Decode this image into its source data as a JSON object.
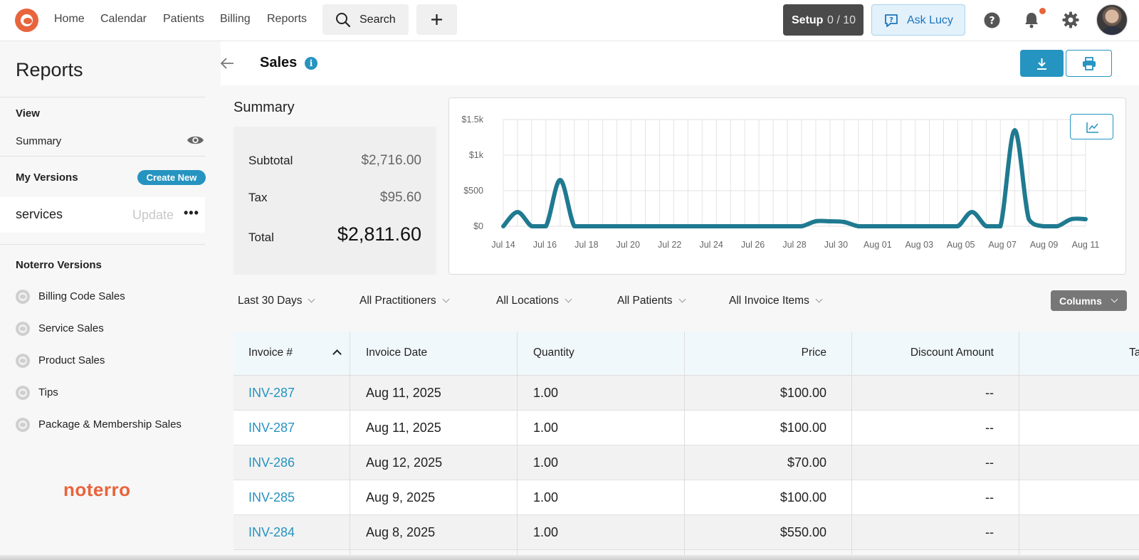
{
  "topnav": {
    "items": [
      "Home",
      "Calendar",
      "Patients",
      "Billing",
      "Reports"
    ],
    "search_label": "Search",
    "setup_label": "Setup",
    "setup_progress": "0 / 10",
    "ask_lucy_label": "Ask Lucy",
    "accent_color": "#e8643c"
  },
  "sidebar": {
    "title": "Reports",
    "view_heading": "View",
    "view_item": "Summary",
    "my_versions_heading": "My Versions",
    "create_new_label": "Create New",
    "version": {
      "name": "services",
      "update_label": "Update",
      "more_label": "•••"
    },
    "noterro_versions_heading": "Noterro Versions",
    "noterro_versions": [
      "Billing Code Sales",
      "Service Sales",
      "Product Sales",
      "Tips",
      "Package & Membership Sales"
    ],
    "brand": "noterro"
  },
  "page": {
    "title": "Sales",
    "summary_label": "Summary",
    "summary": {
      "subtotal_label": "Subtotal",
      "subtotal": "$2,716.00",
      "tax_label": "Tax",
      "tax": "$95.60",
      "total_label": "Total",
      "total": "$2,811.60"
    }
  },
  "chart_data": {
    "type": "line",
    "x_ticks": [
      "Jul 14",
      "Jul 16",
      "Jul 18",
      "Jul 20",
      "Jul 22",
      "Jul 24",
      "Jul 26",
      "Jul 28",
      "Jul 30",
      "Aug 01",
      "Aug 03",
      "Aug 05",
      "Aug 07",
      "Aug 09",
      "Aug 11"
    ],
    "y_ticks": [
      "$1.5k",
      "$1k",
      "$500",
      "$0"
    ],
    "ylim": [
      0,
      1500
    ],
    "series": [
      {
        "color": "#1f7a90",
        "values": [
          0,
          200,
          0,
          0,
          650,
          0,
          0,
          0,
          0,
          0,
          0,
          0,
          0,
          0,
          0,
          0,
          0,
          0,
          0,
          0,
          0,
          0,
          70,
          70,
          60,
          0,
          0,
          0,
          0,
          0,
          0,
          0,
          0,
          200,
          0,
          0,
          1350,
          100,
          0,
          0,
          100,
          100
        ]
      }
    ],
    "grid": true
  },
  "filters": [
    "Last 30 Days",
    "All Practitioners",
    "All Locations",
    "All Patients",
    "All Invoice Items"
  ],
  "columns_label": "Columns",
  "table": {
    "headers": [
      "Invoice #",
      "Invoice Date",
      "Quantity",
      "Price",
      "Discount Amount",
      "Tax"
    ],
    "rows": [
      {
        "invoice": "INV-287",
        "date": "Aug 11, 2025",
        "qty": "1.00",
        "price": "$100.00",
        "discount": "--"
      },
      {
        "invoice": "INV-287",
        "date": "Aug 11, 2025",
        "qty": "1.00",
        "price": "$100.00",
        "discount": "--"
      },
      {
        "invoice": "INV-286",
        "date": "Aug 12, 2025",
        "qty": "1.00",
        "price": "$70.00",
        "discount": "--"
      },
      {
        "invoice": "INV-285",
        "date": "Aug 9, 2025",
        "qty": "1.00",
        "price": "$100.00",
        "discount": "--"
      },
      {
        "invoice": "INV-284",
        "date": "Aug 8, 2025",
        "qty": "1.00",
        "price": "$550.00",
        "discount": "--"
      }
    ]
  }
}
